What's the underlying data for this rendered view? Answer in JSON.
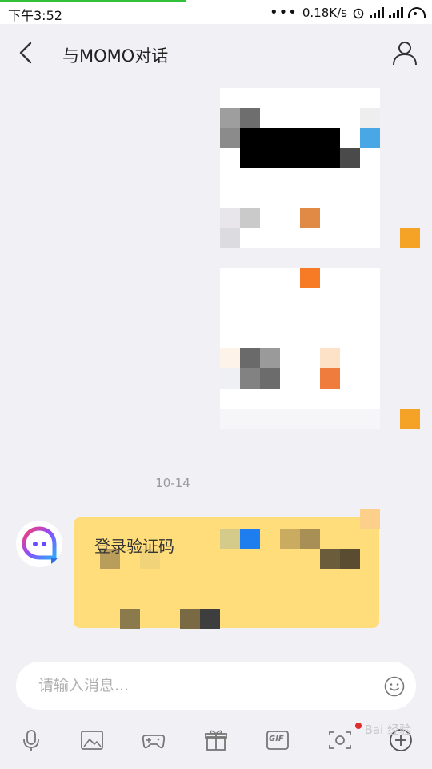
{
  "status_bar": {
    "time": "下午3:52",
    "dots": "•••",
    "network_speed": "0.18K/s",
    "alarm_icon": "alarm-icon",
    "signal_icon": "signal-icon",
    "wifi_icon": "wifi-icon"
  },
  "header": {
    "back_icon": "chevron-left-icon",
    "title": "与MOMO对话",
    "profile_icon": "person-icon"
  },
  "messages": {
    "date_separator": "10-14",
    "incoming_text": "登录验证码"
  },
  "input": {
    "placeholder": "请输入消息..."
  },
  "toolbar": {
    "items": [
      "microphone-icon",
      "image-icon",
      "gamepad-icon",
      "gift-icon",
      "gif-icon",
      "camera-icon",
      "plus-icon"
    ],
    "gif_label": "GIF"
  },
  "watermark": "Bai 经验",
  "colors": {
    "background": "#f1f0f5",
    "incoming_bubble": "#ffdd7a",
    "avatar_orange": "#f4a326",
    "progress_green": "#34c13a",
    "notification_red": "#e02d2d"
  }
}
